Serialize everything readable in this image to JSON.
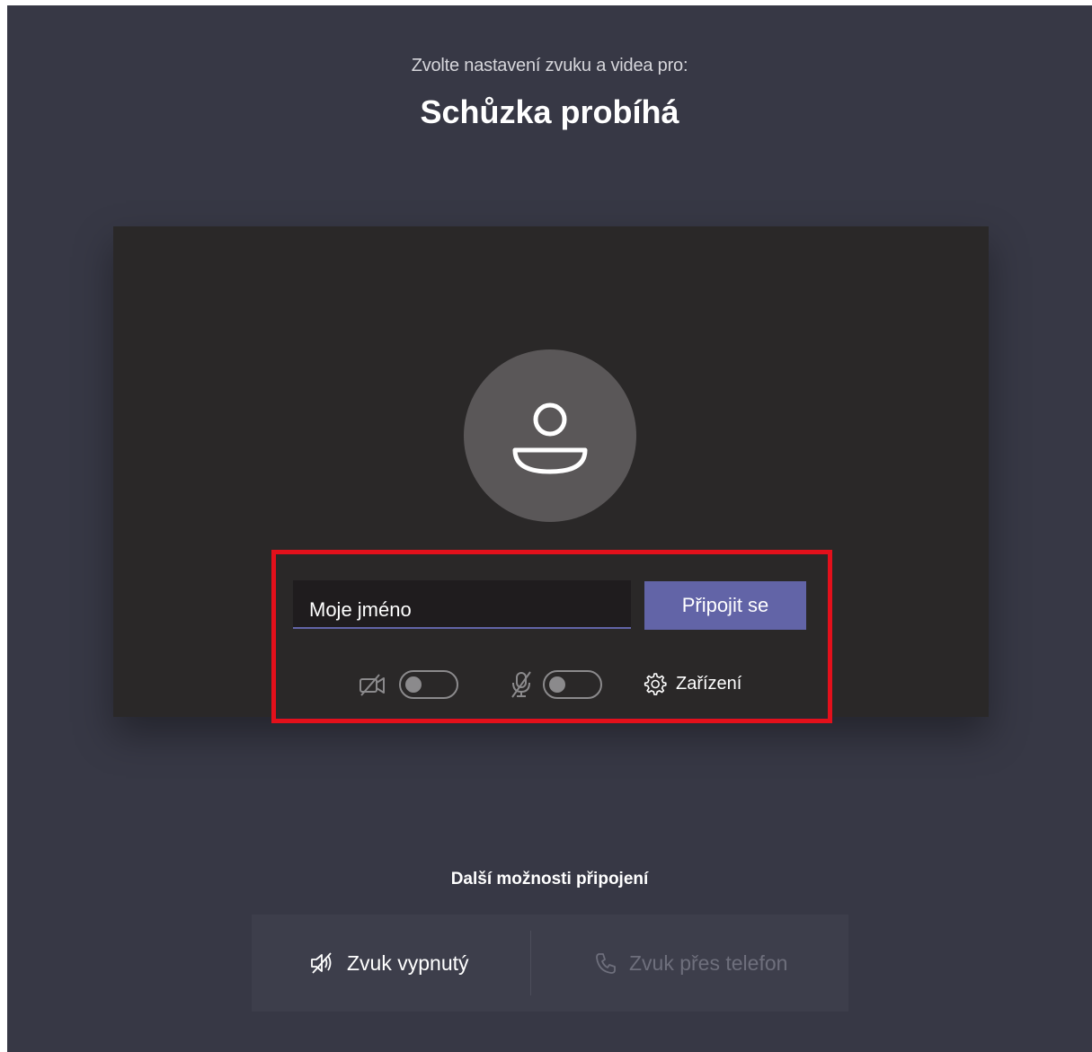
{
  "header": {
    "subtitle": "Zvolte nastavení zvuku a videa pro:",
    "meeting_title": "Schůzka probíhá"
  },
  "prejoin": {
    "name_value": "Moje jméno",
    "join_label": "Připojit se",
    "camera_toggle": "off",
    "mic_toggle": "off",
    "devices_label": "Zařízení"
  },
  "more_options": {
    "title": "Další možnosti připojení",
    "audio_off_label": "Zvuk vypnutý",
    "phone_audio_label": "Zvuk přes telefon"
  },
  "colors": {
    "background": "#373845",
    "preview": "#2a2828",
    "accent": "#6264a7",
    "highlight": "#e3101b"
  }
}
